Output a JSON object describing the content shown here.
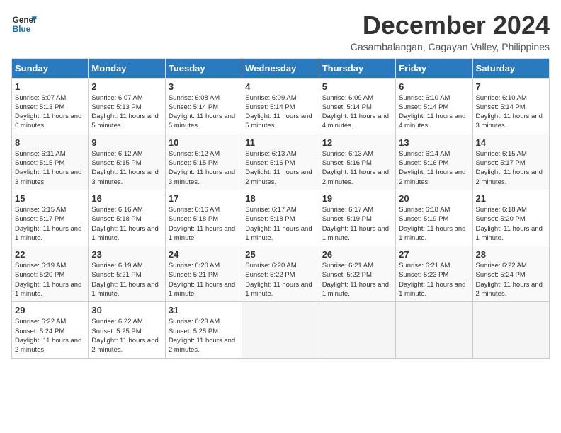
{
  "logo": {
    "line1": "General",
    "line2": "Blue"
  },
  "title": "December 2024",
  "subtitle": "Casambalangan, Cagayan Valley, Philippines",
  "header_days": [
    "Sunday",
    "Monday",
    "Tuesday",
    "Wednesday",
    "Thursday",
    "Friday",
    "Saturday"
  ],
  "weeks": [
    [
      {
        "day": "1",
        "sunrise": "Sunrise: 6:07 AM",
        "sunset": "Sunset: 5:13 PM",
        "daylight": "Daylight: 11 hours and 6 minutes."
      },
      {
        "day": "2",
        "sunrise": "Sunrise: 6:07 AM",
        "sunset": "Sunset: 5:13 PM",
        "daylight": "Daylight: 11 hours and 5 minutes."
      },
      {
        "day": "3",
        "sunrise": "Sunrise: 6:08 AM",
        "sunset": "Sunset: 5:14 PM",
        "daylight": "Daylight: 11 hours and 5 minutes."
      },
      {
        "day": "4",
        "sunrise": "Sunrise: 6:09 AM",
        "sunset": "Sunset: 5:14 PM",
        "daylight": "Daylight: 11 hours and 5 minutes."
      },
      {
        "day": "5",
        "sunrise": "Sunrise: 6:09 AM",
        "sunset": "Sunset: 5:14 PM",
        "daylight": "Daylight: 11 hours and 4 minutes."
      },
      {
        "day": "6",
        "sunrise": "Sunrise: 6:10 AM",
        "sunset": "Sunset: 5:14 PM",
        "daylight": "Daylight: 11 hours and 4 minutes."
      },
      {
        "day": "7",
        "sunrise": "Sunrise: 6:10 AM",
        "sunset": "Sunset: 5:14 PM",
        "daylight": "Daylight: 11 hours and 3 minutes."
      }
    ],
    [
      {
        "day": "8",
        "sunrise": "Sunrise: 6:11 AM",
        "sunset": "Sunset: 5:15 PM",
        "daylight": "Daylight: 11 hours and 3 minutes."
      },
      {
        "day": "9",
        "sunrise": "Sunrise: 6:12 AM",
        "sunset": "Sunset: 5:15 PM",
        "daylight": "Daylight: 11 hours and 3 minutes."
      },
      {
        "day": "10",
        "sunrise": "Sunrise: 6:12 AM",
        "sunset": "Sunset: 5:15 PM",
        "daylight": "Daylight: 11 hours and 3 minutes."
      },
      {
        "day": "11",
        "sunrise": "Sunrise: 6:13 AM",
        "sunset": "Sunset: 5:16 PM",
        "daylight": "Daylight: 11 hours and 2 minutes."
      },
      {
        "day": "12",
        "sunrise": "Sunrise: 6:13 AM",
        "sunset": "Sunset: 5:16 PM",
        "daylight": "Daylight: 11 hours and 2 minutes."
      },
      {
        "day": "13",
        "sunrise": "Sunrise: 6:14 AM",
        "sunset": "Sunset: 5:16 PM",
        "daylight": "Daylight: 11 hours and 2 minutes."
      },
      {
        "day": "14",
        "sunrise": "Sunrise: 6:15 AM",
        "sunset": "Sunset: 5:17 PM",
        "daylight": "Daylight: 11 hours and 2 minutes."
      }
    ],
    [
      {
        "day": "15",
        "sunrise": "Sunrise: 6:15 AM",
        "sunset": "Sunset: 5:17 PM",
        "daylight": "Daylight: 11 hours and 1 minute."
      },
      {
        "day": "16",
        "sunrise": "Sunrise: 6:16 AM",
        "sunset": "Sunset: 5:18 PM",
        "daylight": "Daylight: 11 hours and 1 minute."
      },
      {
        "day": "17",
        "sunrise": "Sunrise: 6:16 AM",
        "sunset": "Sunset: 5:18 PM",
        "daylight": "Daylight: 11 hours and 1 minute."
      },
      {
        "day": "18",
        "sunrise": "Sunrise: 6:17 AM",
        "sunset": "Sunset: 5:18 PM",
        "daylight": "Daylight: 11 hours and 1 minute."
      },
      {
        "day": "19",
        "sunrise": "Sunrise: 6:17 AM",
        "sunset": "Sunset: 5:19 PM",
        "daylight": "Daylight: 11 hours and 1 minute."
      },
      {
        "day": "20",
        "sunrise": "Sunrise: 6:18 AM",
        "sunset": "Sunset: 5:19 PM",
        "daylight": "Daylight: 11 hours and 1 minute."
      },
      {
        "day": "21",
        "sunrise": "Sunrise: 6:18 AM",
        "sunset": "Sunset: 5:20 PM",
        "daylight": "Daylight: 11 hours and 1 minute."
      }
    ],
    [
      {
        "day": "22",
        "sunrise": "Sunrise: 6:19 AM",
        "sunset": "Sunset: 5:20 PM",
        "daylight": "Daylight: 11 hours and 1 minute."
      },
      {
        "day": "23",
        "sunrise": "Sunrise: 6:19 AM",
        "sunset": "Sunset: 5:21 PM",
        "daylight": "Daylight: 11 hours and 1 minute."
      },
      {
        "day": "24",
        "sunrise": "Sunrise: 6:20 AM",
        "sunset": "Sunset: 5:21 PM",
        "daylight": "Daylight: 11 hours and 1 minute."
      },
      {
        "day": "25",
        "sunrise": "Sunrise: 6:20 AM",
        "sunset": "Sunset: 5:22 PM",
        "daylight": "Daylight: 11 hours and 1 minute."
      },
      {
        "day": "26",
        "sunrise": "Sunrise: 6:21 AM",
        "sunset": "Sunset: 5:22 PM",
        "daylight": "Daylight: 11 hours and 1 minute."
      },
      {
        "day": "27",
        "sunrise": "Sunrise: 6:21 AM",
        "sunset": "Sunset: 5:23 PM",
        "daylight": "Daylight: 11 hours and 1 minute."
      },
      {
        "day": "28",
        "sunrise": "Sunrise: 6:22 AM",
        "sunset": "Sunset: 5:24 PM",
        "daylight": "Daylight: 11 hours and 2 minutes."
      }
    ],
    [
      {
        "day": "29",
        "sunrise": "Sunrise: 6:22 AM",
        "sunset": "Sunset: 5:24 PM",
        "daylight": "Daylight: 11 hours and 2 minutes."
      },
      {
        "day": "30",
        "sunrise": "Sunrise: 6:22 AM",
        "sunset": "Sunset: 5:25 PM",
        "daylight": "Daylight: 11 hours and 2 minutes."
      },
      {
        "day": "31",
        "sunrise": "Sunrise: 6:23 AM",
        "sunset": "Sunset: 5:25 PM",
        "daylight": "Daylight: 11 hours and 2 minutes."
      },
      null,
      null,
      null,
      null
    ]
  ]
}
